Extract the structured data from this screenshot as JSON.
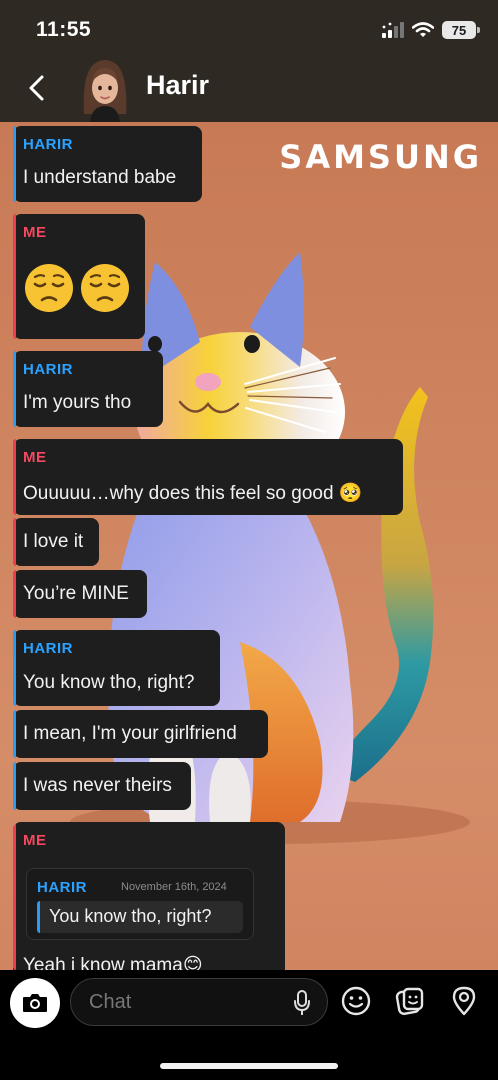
{
  "status_bar": {
    "time": "11:55",
    "battery": "75"
  },
  "header": {
    "title": "Harir"
  },
  "wallpaper": {
    "brand_text": "SAMSUNG"
  },
  "messages": [
    {
      "sender": "HARIR",
      "lines": [
        "I understand babe"
      ]
    },
    {
      "sender": "ME",
      "emoji": [
        "😔",
        "😔"
      ]
    },
    {
      "sender": "HARIR",
      "lines": [
        "I'm yours tho"
      ]
    },
    {
      "sender": "ME",
      "lines": [
        "Ouuuuu…why does this feel so good 🥺",
        "I love it",
        "You’re MINE"
      ]
    },
    {
      "sender": "HARIR",
      "lines": [
        "You know tho, right?",
        "I mean, I'm your girlfriend",
        "I was never theirs"
      ]
    },
    {
      "sender": "ME",
      "quote": {
        "sender": "HARIR",
        "date": "November 16th, 2024",
        "text": "You know tho, right?"
      },
      "lines": [
        "Yeah i know mama😊"
      ]
    }
  ],
  "composer": {
    "placeholder": "Chat"
  },
  "colors": {
    "harir": "#2b9cf0",
    "me": "#f03c52",
    "bar": "#2f2924",
    "bubble": "#1e1e1e"
  },
  "icons": [
    "back-chevron-icon",
    "camera-icon",
    "microphone-icon",
    "emoji-icon",
    "sticker-icon",
    "location-pin-icon",
    "wifi-icon",
    "signal-icon"
  ]
}
